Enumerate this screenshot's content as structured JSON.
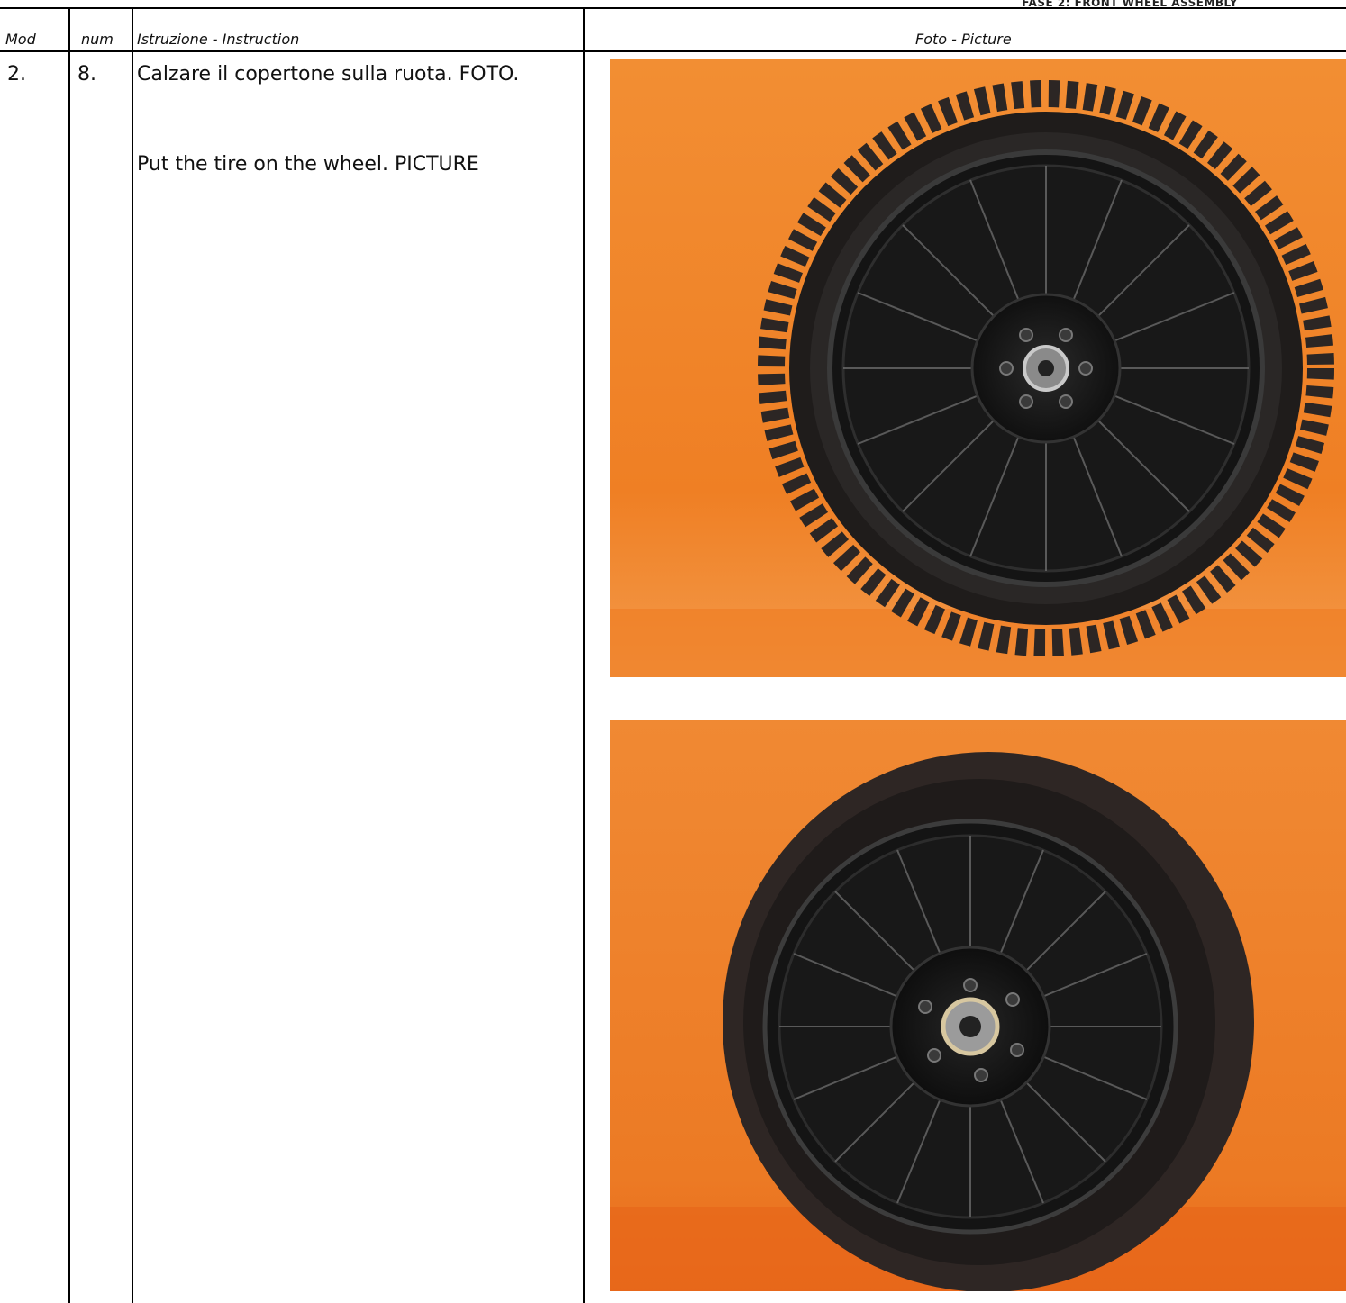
{
  "page": {
    "phase_header": "FASE 2: FRONT WHEEL ASSEMBLY"
  },
  "table": {
    "headers": {
      "mod": "Mod",
      "num": "num",
      "instruction": "Istruzione - Instruction",
      "picture": "Foto - Picture"
    },
    "row": {
      "mod": "2.",
      "num": "8.",
      "instruction_it": "Calzare il copertone sulla ruota. FOTO.",
      "instruction_en": "Put the tire on the wheel. PICTURE"
    }
  },
  "photos": [
    {
      "name": "wheel-with-knobby-tire-photo",
      "background_color": "#f08a30"
    },
    {
      "name": "wheel-with-slick-tire-photo",
      "background_color": "#ee7f2a"
    }
  ]
}
